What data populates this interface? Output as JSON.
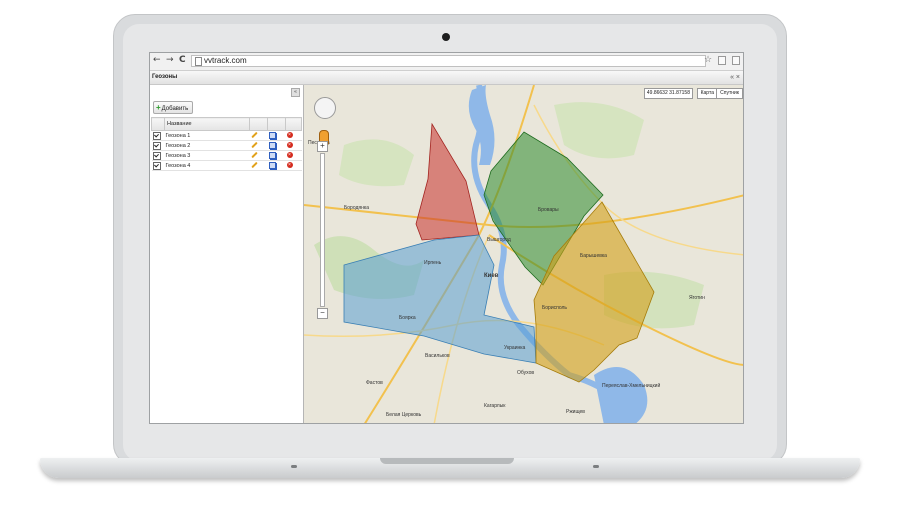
{
  "browser": {
    "back": "←",
    "forward": "→",
    "reload": "C",
    "url": "vvtrack.com",
    "star": "☆"
  },
  "app": {
    "window_title": "Геозоны",
    "title_icons": "« ×"
  },
  "sidebar": {
    "collapse": "«",
    "add_button": "Добавить",
    "column_header": "Название",
    "rows": [
      {
        "name": "Геозона 1",
        "checked": true
      },
      {
        "name": "Геозона 2",
        "checked": true
      },
      {
        "name": "Геозона 3",
        "checked": true
      },
      {
        "name": "Геозона 4",
        "checked": true
      }
    ]
  },
  "map": {
    "coords": "49.86632 31.87158",
    "type_map": "Карта",
    "type_sat": "Спутник",
    "zoom_in": "+",
    "zoom_out": "−",
    "labels": {
      "kiev": "Киев",
      "vyshgorod": "Вышгород",
      "borispol": "Борисполь",
      "vasilkov": "Васильков",
      "fastov": "Фастов",
      "belaya_tserkov": "Белая Церковь",
      "brovary": "Бровары",
      "boyarka": "Боярка",
      "irpen": "Ирпень",
      "obukhov": "Обухов",
      "pereyaslav": "Переяслав-Хмельницкий",
      "baryshevka": "Барышевка",
      "kagarlyk": "Кагарлык",
      "borodyanka": "Бородянка",
      "ukrainka": "Украинка",
      "yagotin": "Яготин",
      "pesochin": "Песковка",
      "rzhishchev": "Ржищев"
    }
  },
  "colors": {
    "zone1": "#c9302c",
    "zone2": "#2e8b2e",
    "zone3": "#5a9fd4",
    "zone4": "#d4a017",
    "water": "#8fb8e8",
    "land": "#e8e4d8"
  }
}
